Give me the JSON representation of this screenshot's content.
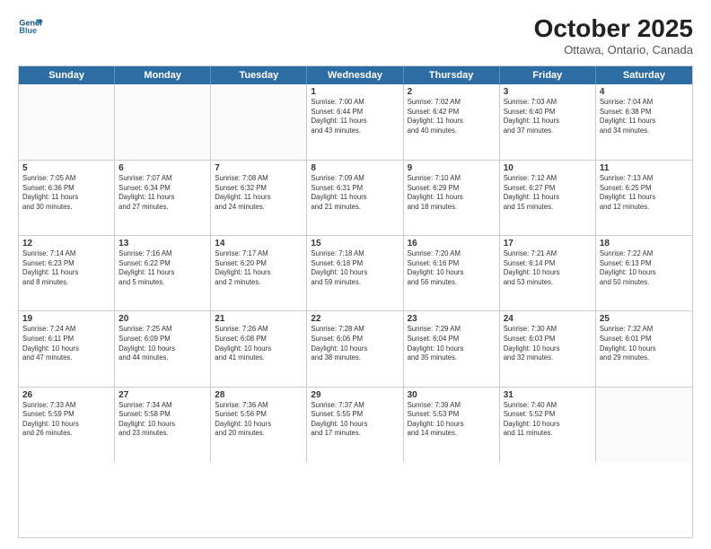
{
  "header": {
    "logo_line1": "General",
    "logo_line2": "Blue",
    "month": "October 2025",
    "location": "Ottawa, Ontario, Canada"
  },
  "weekdays": [
    "Sunday",
    "Monday",
    "Tuesday",
    "Wednesday",
    "Thursday",
    "Friday",
    "Saturday"
  ],
  "weeks": [
    [
      {
        "day": "",
        "info": ""
      },
      {
        "day": "",
        "info": ""
      },
      {
        "day": "",
        "info": ""
      },
      {
        "day": "1",
        "info": "Sunrise: 7:00 AM\nSunset: 6:44 PM\nDaylight: 11 hours\nand 43 minutes."
      },
      {
        "day": "2",
        "info": "Sunrise: 7:02 AM\nSunset: 6:42 PM\nDaylight: 11 hours\nand 40 minutes."
      },
      {
        "day": "3",
        "info": "Sunrise: 7:03 AM\nSunset: 6:40 PM\nDaylight: 11 hours\nand 37 minutes."
      },
      {
        "day": "4",
        "info": "Sunrise: 7:04 AM\nSunset: 6:38 PM\nDaylight: 11 hours\nand 34 minutes."
      }
    ],
    [
      {
        "day": "5",
        "info": "Sunrise: 7:05 AM\nSunset: 6:36 PM\nDaylight: 11 hours\nand 30 minutes."
      },
      {
        "day": "6",
        "info": "Sunrise: 7:07 AM\nSunset: 6:34 PM\nDaylight: 11 hours\nand 27 minutes."
      },
      {
        "day": "7",
        "info": "Sunrise: 7:08 AM\nSunset: 6:32 PM\nDaylight: 11 hours\nand 24 minutes."
      },
      {
        "day": "8",
        "info": "Sunrise: 7:09 AM\nSunset: 6:31 PM\nDaylight: 11 hours\nand 21 minutes."
      },
      {
        "day": "9",
        "info": "Sunrise: 7:10 AM\nSunset: 6:29 PM\nDaylight: 11 hours\nand 18 minutes."
      },
      {
        "day": "10",
        "info": "Sunrise: 7:12 AM\nSunset: 6:27 PM\nDaylight: 11 hours\nand 15 minutes."
      },
      {
        "day": "11",
        "info": "Sunrise: 7:13 AM\nSunset: 6:25 PM\nDaylight: 11 hours\nand 12 minutes."
      }
    ],
    [
      {
        "day": "12",
        "info": "Sunrise: 7:14 AM\nSunset: 6:23 PM\nDaylight: 11 hours\nand 8 minutes."
      },
      {
        "day": "13",
        "info": "Sunrise: 7:16 AM\nSunset: 6:22 PM\nDaylight: 11 hours\nand 5 minutes."
      },
      {
        "day": "14",
        "info": "Sunrise: 7:17 AM\nSunset: 6:20 PM\nDaylight: 11 hours\nand 2 minutes."
      },
      {
        "day": "15",
        "info": "Sunrise: 7:18 AM\nSunset: 6:18 PM\nDaylight: 10 hours\nand 59 minutes."
      },
      {
        "day": "16",
        "info": "Sunrise: 7:20 AM\nSunset: 6:16 PM\nDaylight: 10 hours\nand 56 minutes."
      },
      {
        "day": "17",
        "info": "Sunrise: 7:21 AM\nSunset: 6:14 PM\nDaylight: 10 hours\nand 53 minutes."
      },
      {
        "day": "18",
        "info": "Sunrise: 7:22 AM\nSunset: 6:13 PM\nDaylight: 10 hours\nand 50 minutes."
      }
    ],
    [
      {
        "day": "19",
        "info": "Sunrise: 7:24 AM\nSunset: 6:11 PM\nDaylight: 10 hours\nand 47 minutes."
      },
      {
        "day": "20",
        "info": "Sunrise: 7:25 AM\nSunset: 6:09 PM\nDaylight: 10 hours\nand 44 minutes."
      },
      {
        "day": "21",
        "info": "Sunrise: 7:26 AM\nSunset: 6:08 PM\nDaylight: 10 hours\nand 41 minutes."
      },
      {
        "day": "22",
        "info": "Sunrise: 7:28 AM\nSunset: 6:06 PM\nDaylight: 10 hours\nand 38 minutes."
      },
      {
        "day": "23",
        "info": "Sunrise: 7:29 AM\nSunset: 6:04 PM\nDaylight: 10 hours\nand 35 minutes."
      },
      {
        "day": "24",
        "info": "Sunrise: 7:30 AM\nSunset: 6:03 PM\nDaylight: 10 hours\nand 32 minutes."
      },
      {
        "day": "25",
        "info": "Sunrise: 7:32 AM\nSunset: 6:01 PM\nDaylight: 10 hours\nand 29 minutes."
      }
    ],
    [
      {
        "day": "26",
        "info": "Sunrise: 7:33 AM\nSunset: 5:59 PM\nDaylight: 10 hours\nand 26 minutes."
      },
      {
        "day": "27",
        "info": "Sunrise: 7:34 AM\nSunset: 5:58 PM\nDaylight: 10 hours\nand 23 minutes."
      },
      {
        "day": "28",
        "info": "Sunrise: 7:36 AM\nSunset: 5:56 PM\nDaylight: 10 hours\nand 20 minutes."
      },
      {
        "day": "29",
        "info": "Sunrise: 7:37 AM\nSunset: 5:55 PM\nDaylight: 10 hours\nand 17 minutes."
      },
      {
        "day": "30",
        "info": "Sunrise: 7:39 AM\nSunset: 5:53 PM\nDaylight: 10 hours\nand 14 minutes."
      },
      {
        "day": "31",
        "info": "Sunrise: 7:40 AM\nSunset: 5:52 PM\nDaylight: 10 hours\nand 11 minutes."
      },
      {
        "day": "",
        "info": ""
      }
    ]
  ]
}
